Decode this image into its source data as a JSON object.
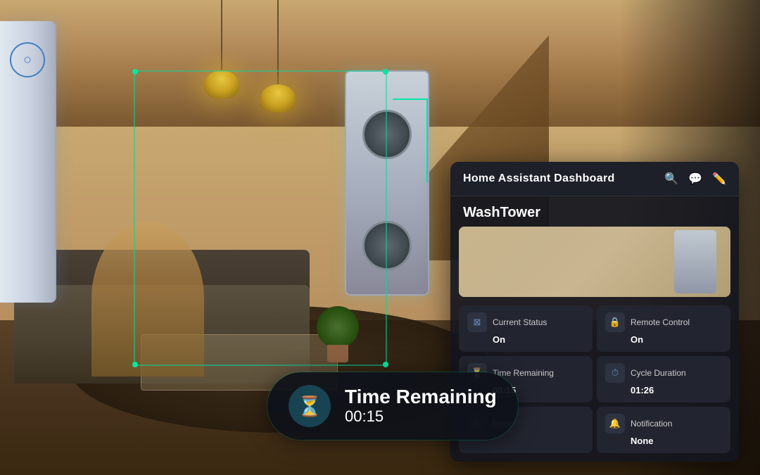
{
  "dashboard": {
    "title": "Home Assistant Dashboard",
    "device_title": "WashTower",
    "icons": {
      "search": "🔍",
      "message": "💬",
      "edit": "✏️"
    },
    "status_cards": [
      {
        "id": "current-status",
        "label": "Current Status",
        "value": "On",
        "icon": "⊠"
      },
      {
        "id": "remote-control",
        "label": "Remote Control",
        "value": "On",
        "icon": "🔒"
      },
      {
        "id": "time-remaining",
        "label": "Time Remaining",
        "value": "00:15",
        "icon": "⏳"
      },
      {
        "id": "cycle-duration",
        "label": "Cycle Duration",
        "value": "01:26",
        "icon": "⏱"
      },
      {
        "id": "error",
        "label": "Error",
        "value": "",
        "icon": "⚠"
      },
      {
        "id": "notification",
        "label": "Notification",
        "value": "None",
        "icon": "🔔"
      }
    ]
  },
  "tooltip": {
    "label": "Time Remaining",
    "value": "00:15",
    "icon": "⏳"
  }
}
